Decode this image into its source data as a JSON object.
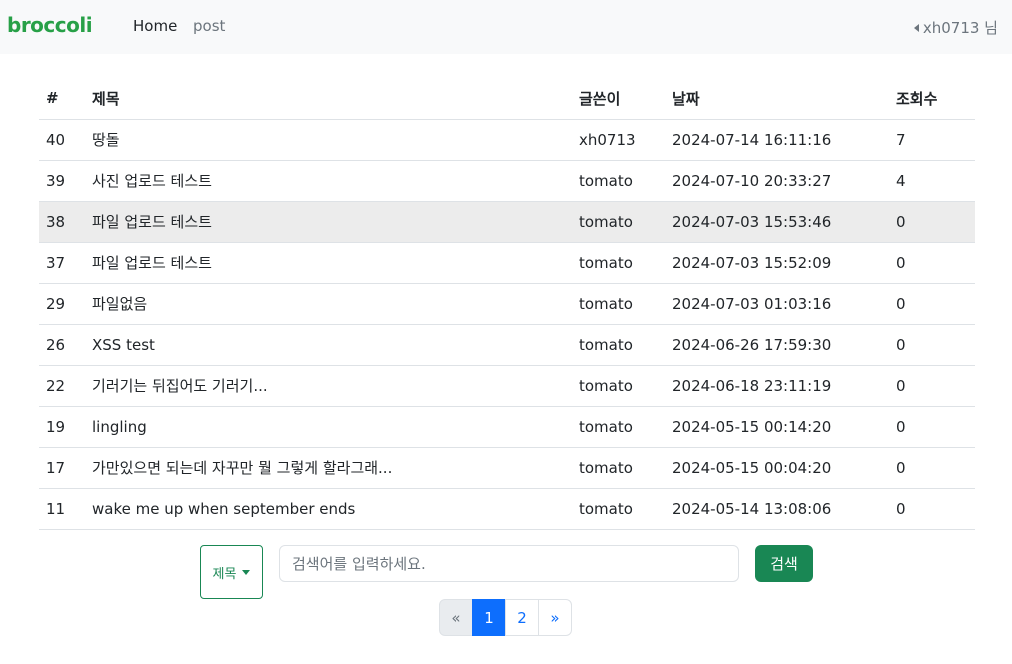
{
  "navbar": {
    "brand": "broccoli",
    "home": "Home",
    "post": "post",
    "user": "xh0713 님"
  },
  "table": {
    "headers": {
      "num": "#",
      "title": "제목",
      "author": "글쓴이",
      "date": "날짜",
      "views": "조회수"
    },
    "rows": [
      {
        "num": "40",
        "title": "땅돌",
        "author": "xh0713",
        "date": "2024-07-14 16:11:16",
        "views": "7"
      },
      {
        "num": "39",
        "title": "사진 업로드 테스트",
        "author": "tomato",
        "date": "2024-07-10 20:33:27",
        "views": "4"
      },
      {
        "num": "38",
        "title": "파일 업로드 테스트",
        "author": "tomato",
        "date": "2024-07-03 15:53:46",
        "views": "0"
      },
      {
        "num": "37",
        "title": "파일 업로드 테스트",
        "author": "tomato",
        "date": "2024-07-03 15:52:09",
        "views": "0"
      },
      {
        "num": "29",
        "title": "파일없음",
        "author": "tomato",
        "date": "2024-07-03 01:03:16",
        "views": "0"
      },
      {
        "num": "26",
        "title": "XSS test",
        "author": "tomato",
        "date": "2024-06-26 17:59:30",
        "views": "0"
      },
      {
        "num": "22",
        "title": "기러기는 뒤집어도 기러기...",
        "author": "tomato",
        "date": "2024-06-18 23:11:19",
        "views": "0"
      },
      {
        "num": "19",
        "title": "lingling",
        "author": "tomato",
        "date": "2024-05-15 00:14:20",
        "views": "0"
      },
      {
        "num": "17",
        "title": "가만있으면 되는데 자꾸만 뭘 그렇게 할라그래...",
        "author": "tomato",
        "date": "2024-05-15 00:04:20",
        "views": "0"
      },
      {
        "num": "11",
        "title": "wake me up when september ends",
        "author": "tomato",
        "date": "2024-05-14 13:08:06",
        "views": "0"
      }
    ]
  },
  "search": {
    "field_selected": "제목",
    "placeholder": "검색어를 입력하세요.",
    "value": "",
    "button": "검색"
  },
  "pagination": {
    "prev": "«",
    "pages": [
      "1",
      "2"
    ],
    "next": "»",
    "current": "1"
  },
  "colors": {
    "brand": "#27a047",
    "primary": "#0d6efd",
    "success": "#198754",
    "navbar_bg": "#f8f9fa",
    "row_hover": "#ececec"
  }
}
